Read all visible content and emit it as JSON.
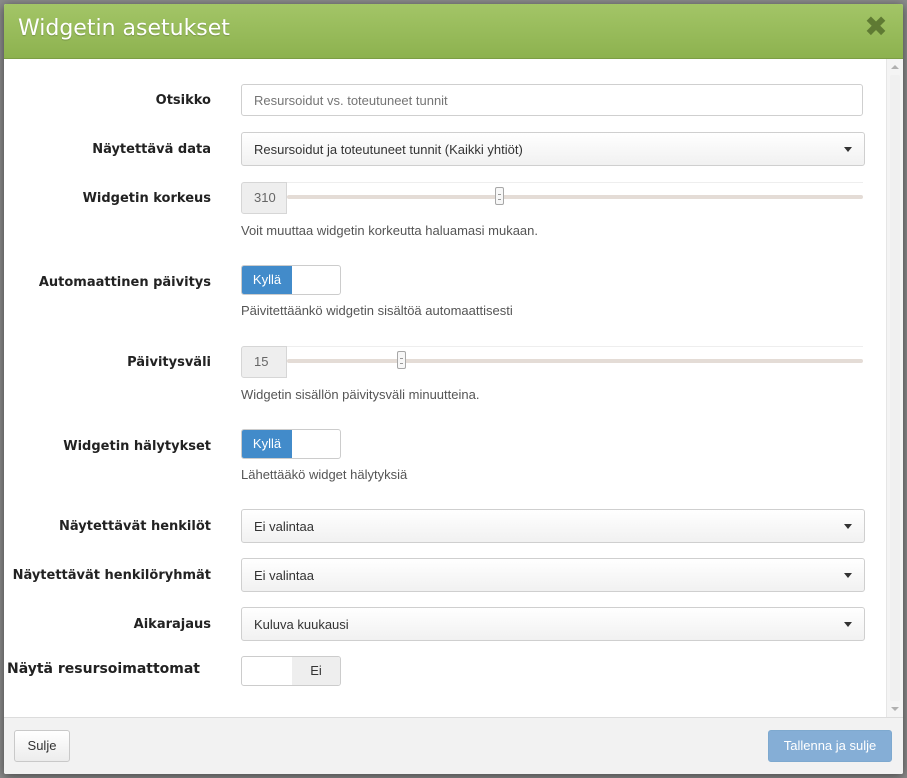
{
  "dialog": {
    "title": "Widgetin asetukset",
    "close_glyph": "✖"
  },
  "form": {
    "title_field": {
      "label": "Otsikko",
      "placeholder": "Resursoidut vs. toteutuneet tunnit",
      "value": ""
    },
    "data_field": {
      "label": "Näytettävä data",
      "value": "Resursoidut ja toteutuneet tunnit (Kaikki yhtiöt)"
    },
    "height_field": {
      "label": "Widgetin korkeus",
      "value": "310",
      "position": 0.37,
      "help": "Voit muuttaa widgetin korkeutta haluamasi mukaan."
    },
    "auto_refresh": {
      "label": "Automaattinen päivitys",
      "state_label": "Kyllä",
      "enabled": true,
      "help": "Päivitettäänkö widgetin sisältöä automaattisesti"
    },
    "refresh_interval": {
      "label": "Päivitysväli",
      "value": "15",
      "position": 0.2,
      "help": "Widgetin sisällön päivitysväli minuutteina."
    },
    "alerts": {
      "label": "Widgetin hälytykset",
      "state_label": "Kyllä",
      "enabled": true,
      "help": "Lähettääkö widget hälytyksiä"
    },
    "persons": {
      "label": "Näytettävät henkilöt",
      "value": "Ei valintaa"
    },
    "person_groups": {
      "label": "Näytettävät henkilöryhmät",
      "value": "Ei valintaa"
    },
    "time_range": {
      "label": "Aikarajaus",
      "value": "Kuluva kuukausi"
    },
    "show_unresourced": {
      "label": "Näytä resursoimattomat",
      "state_label": "Ei",
      "enabled": false
    }
  },
  "footer": {
    "close_label": "Sulje",
    "save_label": "Tallenna ja sulje"
  },
  "colors": {
    "header": "#8db24f",
    "toggle_on": "#428bca",
    "save_button": "#85aed6"
  }
}
